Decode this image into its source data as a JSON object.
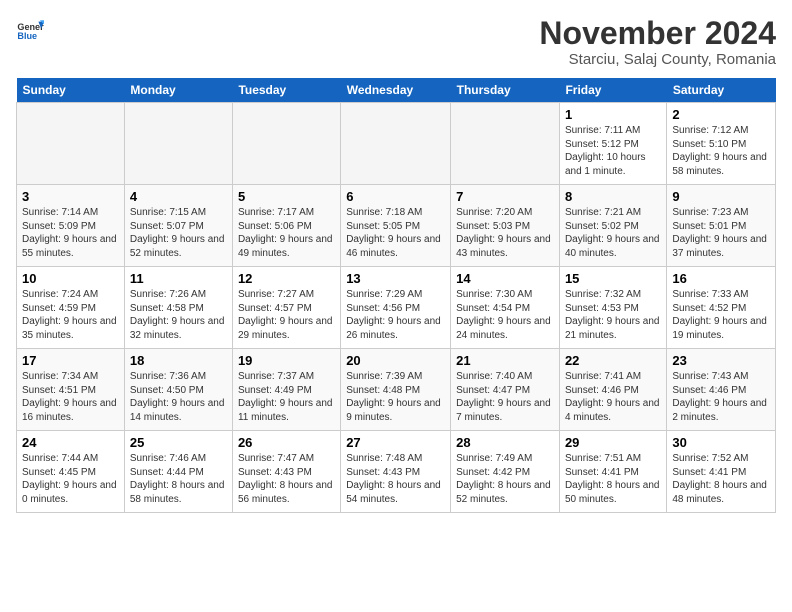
{
  "header": {
    "logo_line1": "General",
    "logo_line2": "Blue",
    "title": "November 2024",
    "subtitle": "Starciu, Salaj County, Romania"
  },
  "weekdays": [
    "Sunday",
    "Monday",
    "Tuesday",
    "Wednesday",
    "Thursday",
    "Friday",
    "Saturday"
  ],
  "weeks": [
    [
      {
        "day": "",
        "info": ""
      },
      {
        "day": "",
        "info": ""
      },
      {
        "day": "",
        "info": ""
      },
      {
        "day": "",
        "info": ""
      },
      {
        "day": "",
        "info": ""
      },
      {
        "day": "1",
        "info": "Sunrise: 7:11 AM\nSunset: 5:12 PM\nDaylight: 10 hours and 1 minute."
      },
      {
        "day": "2",
        "info": "Sunrise: 7:12 AM\nSunset: 5:10 PM\nDaylight: 9 hours and 58 minutes."
      }
    ],
    [
      {
        "day": "3",
        "info": "Sunrise: 7:14 AM\nSunset: 5:09 PM\nDaylight: 9 hours and 55 minutes."
      },
      {
        "day": "4",
        "info": "Sunrise: 7:15 AM\nSunset: 5:07 PM\nDaylight: 9 hours and 52 minutes."
      },
      {
        "day": "5",
        "info": "Sunrise: 7:17 AM\nSunset: 5:06 PM\nDaylight: 9 hours and 49 minutes."
      },
      {
        "day": "6",
        "info": "Sunrise: 7:18 AM\nSunset: 5:05 PM\nDaylight: 9 hours and 46 minutes."
      },
      {
        "day": "7",
        "info": "Sunrise: 7:20 AM\nSunset: 5:03 PM\nDaylight: 9 hours and 43 minutes."
      },
      {
        "day": "8",
        "info": "Sunrise: 7:21 AM\nSunset: 5:02 PM\nDaylight: 9 hours and 40 minutes."
      },
      {
        "day": "9",
        "info": "Sunrise: 7:23 AM\nSunset: 5:01 PM\nDaylight: 9 hours and 37 minutes."
      }
    ],
    [
      {
        "day": "10",
        "info": "Sunrise: 7:24 AM\nSunset: 4:59 PM\nDaylight: 9 hours and 35 minutes."
      },
      {
        "day": "11",
        "info": "Sunrise: 7:26 AM\nSunset: 4:58 PM\nDaylight: 9 hours and 32 minutes."
      },
      {
        "day": "12",
        "info": "Sunrise: 7:27 AM\nSunset: 4:57 PM\nDaylight: 9 hours and 29 minutes."
      },
      {
        "day": "13",
        "info": "Sunrise: 7:29 AM\nSunset: 4:56 PM\nDaylight: 9 hours and 26 minutes."
      },
      {
        "day": "14",
        "info": "Sunrise: 7:30 AM\nSunset: 4:54 PM\nDaylight: 9 hours and 24 minutes."
      },
      {
        "day": "15",
        "info": "Sunrise: 7:32 AM\nSunset: 4:53 PM\nDaylight: 9 hours and 21 minutes."
      },
      {
        "day": "16",
        "info": "Sunrise: 7:33 AM\nSunset: 4:52 PM\nDaylight: 9 hours and 19 minutes."
      }
    ],
    [
      {
        "day": "17",
        "info": "Sunrise: 7:34 AM\nSunset: 4:51 PM\nDaylight: 9 hours and 16 minutes."
      },
      {
        "day": "18",
        "info": "Sunrise: 7:36 AM\nSunset: 4:50 PM\nDaylight: 9 hours and 14 minutes."
      },
      {
        "day": "19",
        "info": "Sunrise: 7:37 AM\nSunset: 4:49 PM\nDaylight: 9 hours and 11 minutes."
      },
      {
        "day": "20",
        "info": "Sunrise: 7:39 AM\nSunset: 4:48 PM\nDaylight: 9 hours and 9 minutes."
      },
      {
        "day": "21",
        "info": "Sunrise: 7:40 AM\nSunset: 4:47 PM\nDaylight: 9 hours and 7 minutes."
      },
      {
        "day": "22",
        "info": "Sunrise: 7:41 AM\nSunset: 4:46 PM\nDaylight: 9 hours and 4 minutes."
      },
      {
        "day": "23",
        "info": "Sunrise: 7:43 AM\nSunset: 4:46 PM\nDaylight: 9 hours and 2 minutes."
      }
    ],
    [
      {
        "day": "24",
        "info": "Sunrise: 7:44 AM\nSunset: 4:45 PM\nDaylight: 9 hours and 0 minutes."
      },
      {
        "day": "25",
        "info": "Sunrise: 7:46 AM\nSunset: 4:44 PM\nDaylight: 8 hours and 58 minutes."
      },
      {
        "day": "26",
        "info": "Sunrise: 7:47 AM\nSunset: 4:43 PM\nDaylight: 8 hours and 56 minutes."
      },
      {
        "day": "27",
        "info": "Sunrise: 7:48 AM\nSunset: 4:43 PM\nDaylight: 8 hours and 54 minutes."
      },
      {
        "day": "28",
        "info": "Sunrise: 7:49 AM\nSunset: 4:42 PM\nDaylight: 8 hours and 52 minutes."
      },
      {
        "day": "29",
        "info": "Sunrise: 7:51 AM\nSunset: 4:41 PM\nDaylight: 8 hours and 50 minutes."
      },
      {
        "day": "30",
        "info": "Sunrise: 7:52 AM\nSunset: 4:41 PM\nDaylight: 8 hours and 48 minutes."
      }
    ]
  ]
}
